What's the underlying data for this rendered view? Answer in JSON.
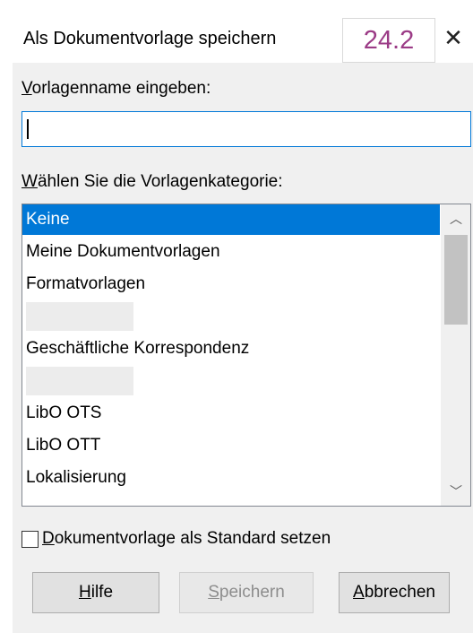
{
  "window": {
    "title": "Als Dokumentvorlage speichern",
    "version_badge": "24.2",
    "close_glyph": "✕"
  },
  "name_section": {
    "label_mnemonic": "V",
    "label_rest": "orlagenname eingeben:",
    "input_value": ""
  },
  "category_section": {
    "label_mnemonic": "W",
    "label_rest": "ählen Sie die Vorlagenkategorie:",
    "items": [
      {
        "label": "Keine",
        "selected": true,
        "redacted": false
      },
      {
        "label": "Meine Dokumentvorlagen",
        "selected": false,
        "redacted": false
      },
      {
        "label": "Formatvorlagen",
        "selected": false,
        "redacted": false
      },
      {
        "label": "",
        "selected": false,
        "redacted": true
      },
      {
        "label": "Geschäftliche Korrespondenz",
        "selected": false,
        "redacted": false
      },
      {
        "label": "",
        "selected": false,
        "redacted": true
      },
      {
        "label": "LibO OTS",
        "selected": false,
        "redacted": false
      },
      {
        "label": "LibO OTT",
        "selected": false,
        "redacted": false
      },
      {
        "label": "Lokalisierung",
        "selected": false,
        "redacted": false
      }
    ],
    "scroll_up_glyph": "︿",
    "scroll_down_glyph": "﹀"
  },
  "default_checkbox": {
    "checked": false,
    "label_mnemonic": "D",
    "label_rest": "okumentvorlage als Standard setzen"
  },
  "buttons": {
    "help": {
      "mnemonic": "H",
      "rest": "ilfe",
      "enabled": true
    },
    "save": {
      "mnemonic": "S",
      "rest": "peichern",
      "enabled": false
    },
    "cancel": {
      "mnemonic": "A",
      "rest": "bbrechen",
      "enabled": true
    }
  },
  "colors": {
    "selection": "#0078d7",
    "badge_text": "#9b3b86",
    "dialog_bg": "#f0f0f0"
  }
}
